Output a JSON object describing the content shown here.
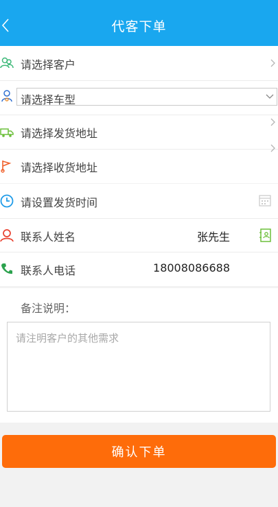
{
  "header": {
    "title": "代客下单",
    "back_icon": "chevron-left-icon"
  },
  "form": {
    "customer": {
      "label": "请选择客户",
      "icon": "users-icon"
    },
    "vehicle": {
      "selected": "请选择车型",
      "icon": "driver-icon"
    },
    "pickup": {
      "label": "请选择发货地址",
      "icon": "truck-icon"
    },
    "delivery": {
      "label": "请选择收货地址",
      "icon": "flag-icon"
    },
    "ship_time": {
      "label": "请设置发货时间",
      "icon": "clock-icon",
      "action_icon": "calendar-icon"
    },
    "contact_name": {
      "label": "联系人姓名",
      "value": "张先生",
      "icon": "person-icon",
      "action_icon": "contacts-book-icon"
    },
    "contact_phone": {
      "label": "联系人电话",
      "value": "18008086688",
      "icon": "phone-icon"
    }
  },
  "notes": {
    "title": "备注说明：",
    "placeholder": "请注明客户的其他需求",
    "value": ""
  },
  "actions": {
    "confirm_label": "确认下单"
  },
  "colors": {
    "header": "#19a7ef",
    "confirm": "#fe6c0a",
    "background": "#f2f2f2"
  }
}
